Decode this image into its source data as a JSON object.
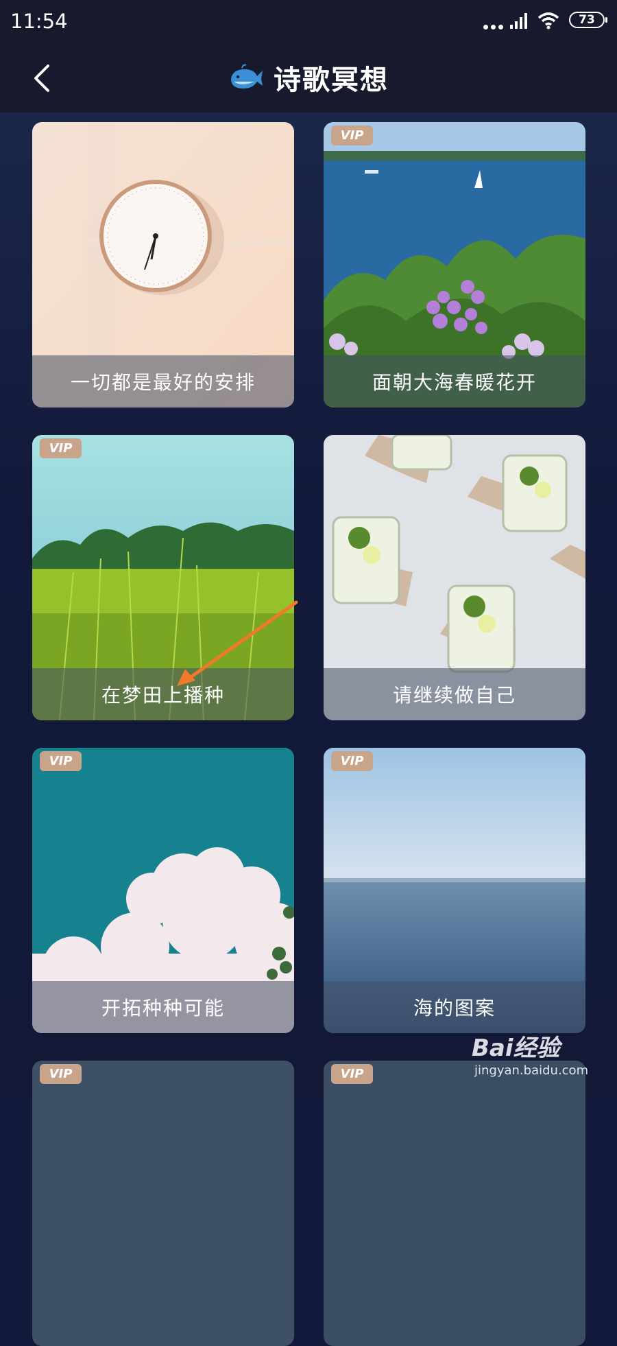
{
  "status_bar": {
    "time": "11:54",
    "battery": "73"
  },
  "header": {
    "title": "诗歌冥想"
  },
  "cards": [
    {
      "title": "一切都是最好的安排",
      "vip": false
    },
    {
      "title": "面朝大海春暖花开",
      "vip": true,
      "badge": "VIP"
    },
    {
      "title": "在梦田上播种",
      "vip": true,
      "badge": "VIP"
    },
    {
      "title": "请继续做自己",
      "vip": false
    },
    {
      "title": "开拓种种可能",
      "vip": true,
      "badge": "VIP"
    },
    {
      "title": "海的图案",
      "vip": true,
      "badge": "VIP"
    },
    {
      "title": "",
      "vip": true,
      "badge": "VIP"
    },
    {
      "title": "",
      "vip": true,
      "badge": "VIP"
    }
  ],
  "watermark": {
    "logo": "Bai经验",
    "url": "jingyan.baidu.com"
  },
  "colors": {
    "background": "#13193a",
    "header": "#171a2d",
    "vip": "#c8a58a",
    "arrow": "#f07a2a"
  }
}
